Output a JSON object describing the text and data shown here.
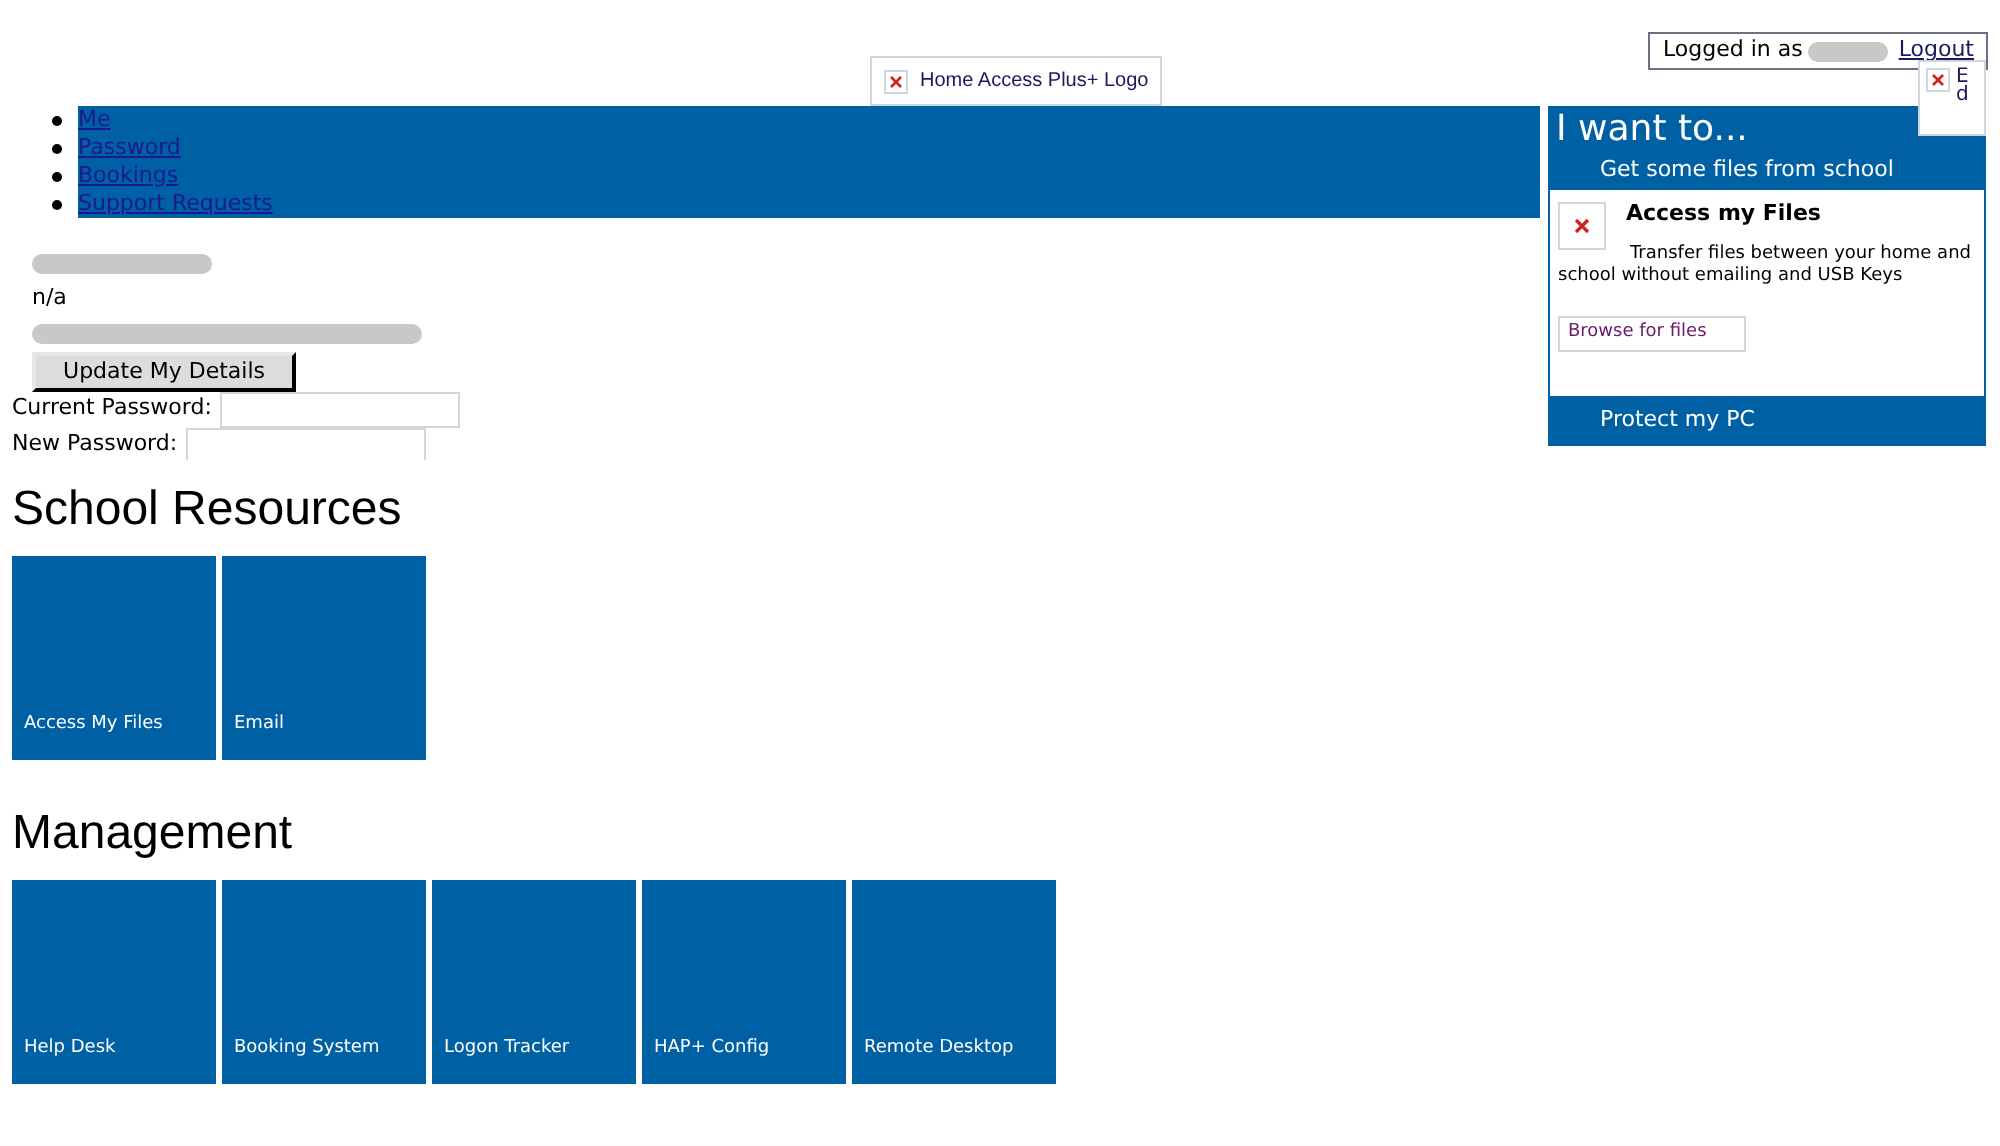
{
  "header": {
    "logo_alt": "Home Access Plus+ Logo",
    "login": {
      "prefix": "Logged in as",
      "logout": "Logout"
    },
    "broken_image_alt": "Ed"
  },
  "nav": {
    "items": [
      "Me",
      "Password",
      "Bookings",
      "Support Requests"
    ]
  },
  "profile": {
    "department": "n/a",
    "update_button": "Update My Details",
    "fields": [
      {
        "label": "Current Password:"
      },
      {
        "label": "New Password:"
      }
    ]
  },
  "i_want_to": {
    "title": "I want to...",
    "sections": [
      {
        "heading": "Get some files from school",
        "expanded": true,
        "item_title": "Access my Files",
        "item_text": "Transfer files between your home and school without emailing and USB Keys",
        "link": "Browse for files"
      },
      {
        "heading": "Protect my PC",
        "expanded": false
      }
    ]
  },
  "groups": [
    {
      "title": "School Resources",
      "tiles": [
        "Access My Files",
        "Email"
      ]
    },
    {
      "title": "Management",
      "tiles": [
        "Help Desk",
        "Booking System",
        "Logon Tracker",
        "HAP+ Config",
        "Remote Desktop"
      ]
    }
  ]
}
